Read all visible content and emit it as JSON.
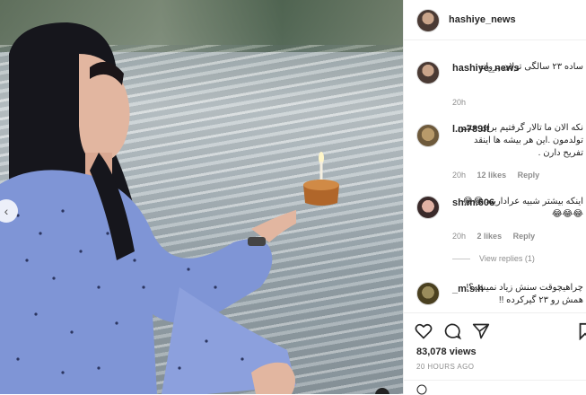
{
  "post": {
    "username": "hashiye_news",
    "caption_username": "hashiye_news",
    "caption": "ساده ۲۳ سالگی ترلان پروانه",
    "caption_time": "20h",
    "views": "83,078 views",
    "time_ago": "20 HOURS AGO"
  },
  "comments": [
    {
      "username": "l.m789ft",
      "text": "نکه الان ما تالار گرفتیم برای جشن تولدمون .این هر بیشه ها اینقد تفریح دارن .",
      "time": "20h",
      "likes": "12 likes",
      "reply": "Reply"
    },
    {
      "username": "sh.m.606",
      "text": "اینکه بیشتر شبیه عرادارییه 😂😂😂😂😂",
      "time": "20h",
      "likes": "2 likes",
      "reply": "Reply",
      "view_replies": "View replies (1)"
    },
    {
      "username": "_m.s.h",
      "text": "چراهیچوقت سنش زیاد نمیشه؟! همش رو ۲۳ گیرکرده !!",
      "time": "",
      "likes": "",
      "reply": ""
    }
  ],
  "icons": [
    "heart-icon",
    "comment-icon",
    "share-icon",
    "bookmark-icon"
  ]
}
